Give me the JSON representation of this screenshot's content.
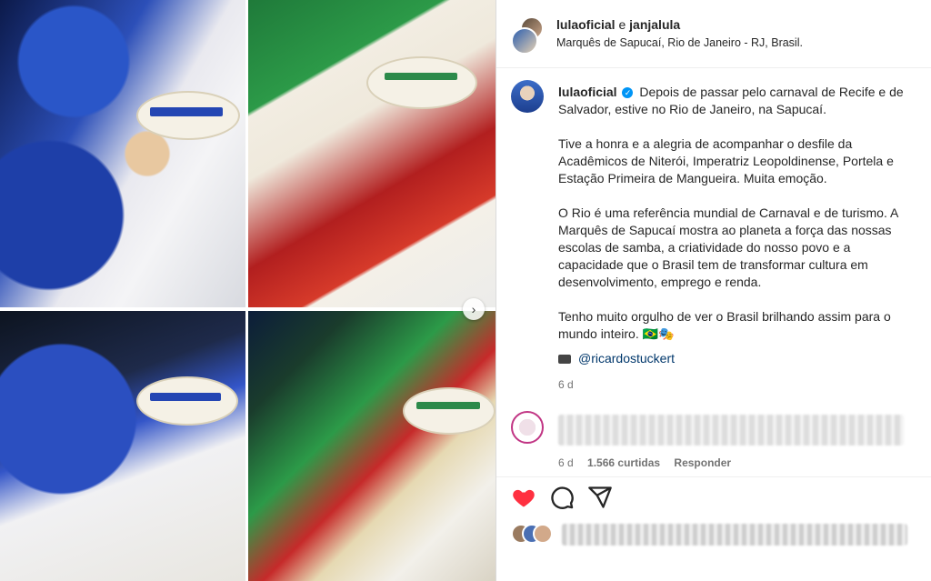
{
  "post": {
    "header": {
      "user_primary": "lulaoficial",
      "connector": "e",
      "user_secondary": "janjalula",
      "location": "Marquês de Sapucaí, Rio de Janeiro - RJ, Brasil."
    },
    "caption": {
      "username": "lulaoficial",
      "verified_icon": "verified-badge-icon",
      "paragraphs": [
        "Depois de passar pelo carnaval de Recife e de Salvador, estive no Rio de Janeiro, na Sapucaí.",
        "Tive a honra e a alegria de acompanhar o desfile da Acadêmicos de Niterói, Imperatriz Leopoldinense, Portela e Estação Primeira de Mangueira. Muita emoção.",
        "O Rio é uma referência mundial de Carnaval e de turismo. A Marquês de Sapucaí mostra ao planeta a força das nossas escolas de samba, a criatividade do nosso povo e a capacidade que o Brasil tem de transformar cultura em desenvolvimento, emprego e renda.",
        "Tenho muito orgulho de ver o Brasil brilhando assim para o mundo inteiro. 🇧🇷🎭"
      ],
      "mention": "@ricardostuckert",
      "time": "6 d"
    },
    "comment": {
      "time": "6 d",
      "likes": "1.566 curtidas",
      "reply": "Responder"
    },
    "actions": {
      "like_icon": "heart-icon",
      "comment_icon": "comment-icon",
      "share_icon": "share-icon"
    },
    "accent": "#0095f6",
    "like_color": "#ff3040"
  }
}
